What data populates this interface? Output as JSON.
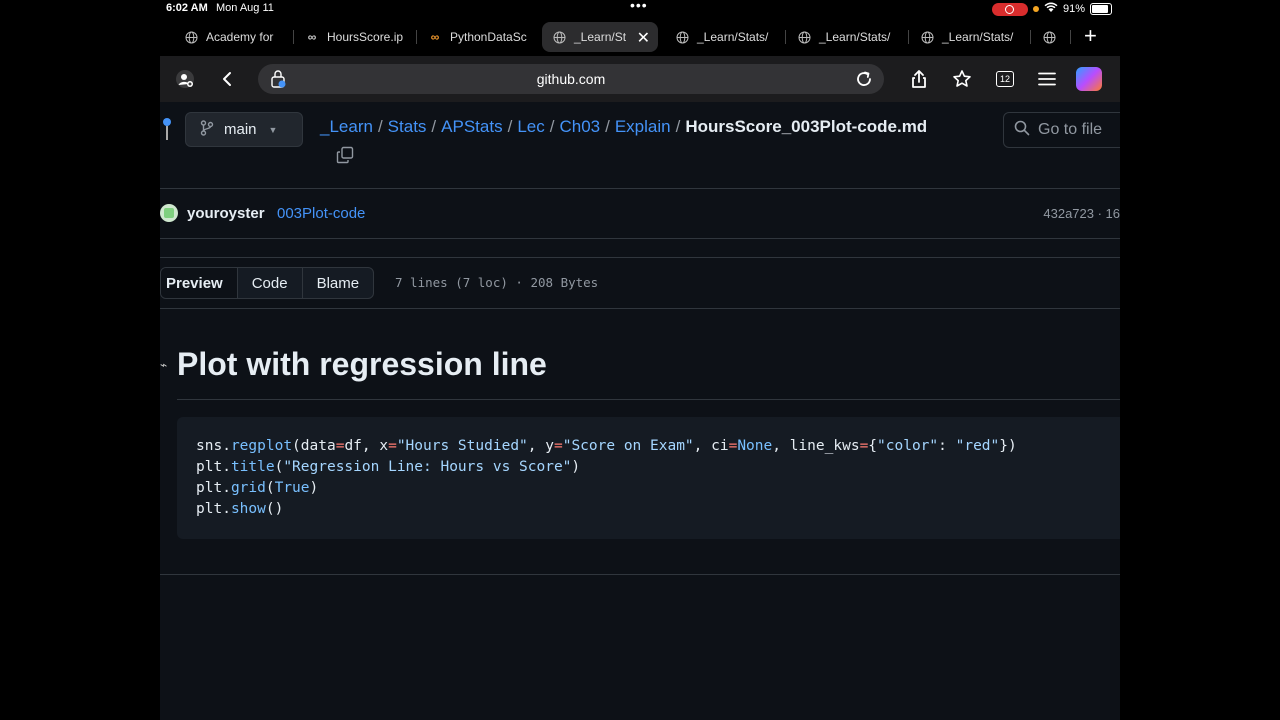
{
  "status_bar": {
    "time": "6:02 AM",
    "date": "Mon Aug 11",
    "battery": "91%"
  },
  "tabs": [
    {
      "label": "Academy for",
      "icon": "globe-icon"
    },
    {
      "label": "HoursScore.ip",
      "icon": "colab-icon"
    },
    {
      "label": "PythonDataSc",
      "icon": "colab-icon"
    },
    {
      "label": "_Learn/St",
      "icon": "globe-icon",
      "active": true
    },
    {
      "label": "_Learn/Stats/",
      "icon": "globe-icon"
    },
    {
      "label": "_Learn/Stats/",
      "icon": "globe-icon"
    },
    {
      "label": "_Learn/Stats/",
      "icon": "globe-icon"
    }
  ],
  "address_bar": {
    "host": "github.com",
    "tab_count": "12"
  },
  "repo": {
    "branch": "main",
    "breadcrumbs": [
      "_Learn",
      "Stats",
      "APStats",
      "Lec",
      "Ch03",
      "Explain"
    ],
    "file_name": "HoursScore_003Plot-code.md",
    "search_placeholder": "Go to file"
  },
  "commit": {
    "author": "youroyster",
    "message": "003Plot-code",
    "hash": "432a723 · 16"
  },
  "view": {
    "modes": [
      "Preview",
      "Code",
      "Blame"
    ],
    "meta": "7 lines (7 loc) · 208 Bytes"
  },
  "content": {
    "heading": "Plot with regression line",
    "code": {
      "l1_obj": "sns",
      "l1_fn": "regplot",
      "l1_a": "(data",
      "l1_b": "df, x",
      "l1_s1": "\"Hours Studied\"",
      "l1_c": ", y",
      "l1_s2": "\"Score on Exam\"",
      "l1_d": ", ci",
      "l1_none": "None",
      "l1_e": ", line_kws",
      "l1_f": "{",
      "l1_s3": "\"color\"",
      "l1_g": ": ",
      "l1_s4": "\"red\"",
      "l1_h": "})",
      "l2_obj": "plt",
      "l2_fn": "title",
      "l2_s": "\"Regression Line: Hours vs Score\"",
      "l3_obj": "plt",
      "l3_fn": "grid",
      "l3_true": "True",
      "l4_obj": "plt",
      "l4_fn": "show",
      "l4_p": "()"
    }
  }
}
